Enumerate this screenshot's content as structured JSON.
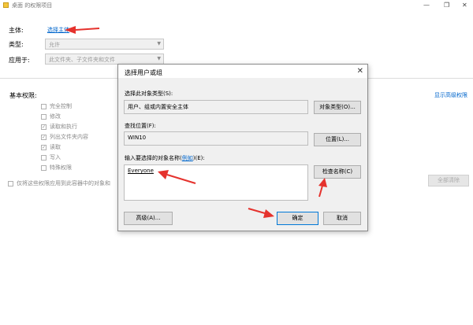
{
  "window": {
    "title": "桌面 的权限项目",
    "minimize": "—",
    "maximize": "❐",
    "close": "✕"
  },
  "form": {
    "principal_label": "主体:",
    "principal_link": "选择主体",
    "type_label": "类型:",
    "type_value": "允许",
    "applies_label": "应用于:",
    "applies_value": "此文件夹、子文件夹和文件"
  },
  "permissions": {
    "title": "基本权限:",
    "advanced_link": "显示高级权限",
    "items": [
      {
        "label": "完全控制",
        "checked": false
      },
      {
        "label": "修改",
        "checked": false
      },
      {
        "label": "读取和执行",
        "checked": true
      },
      {
        "label": "列出文件夹内容",
        "checked": true
      },
      {
        "label": "读取",
        "checked": true
      },
      {
        "label": "写入",
        "checked": false
      },
      {
        "label": "特殊权限",
        "checked": false
      }
    ],
    "apply_only": "仅将这些权限应用到此容器中的对象和",
    "clear_all": "全部清除"
  },
  "dialog": {
    "title": "选择用户或组",
    "close": "✕",
    "object_type_label": "选择此对象类型(S):",
    "object_type_value": "用户、组或内置安全主体",
    "object_type_btn": "对象类型(O)...",
    "location_label": "查找位置(F):",
    "location_value": "WIN10",
    "location_btn": "位置(L)...",
    "names_label_prefix": "输入要选择的对象名称(",
    "names_label_link": "例如",
    "names_label_suffix": ")(E):",
    "names_value": "Everyone",
    "check_names_btn": "检查名称(C)",
    "advanced_btn": "高级(A)...",
    "ok_btn": "确定",
    "cancel_btn": "取消"
  },
  "colors": {
    "link": "#0066cc",
    "arrow": "#e5322d",
    "default_button_border": "#0078d7"
  }
}
